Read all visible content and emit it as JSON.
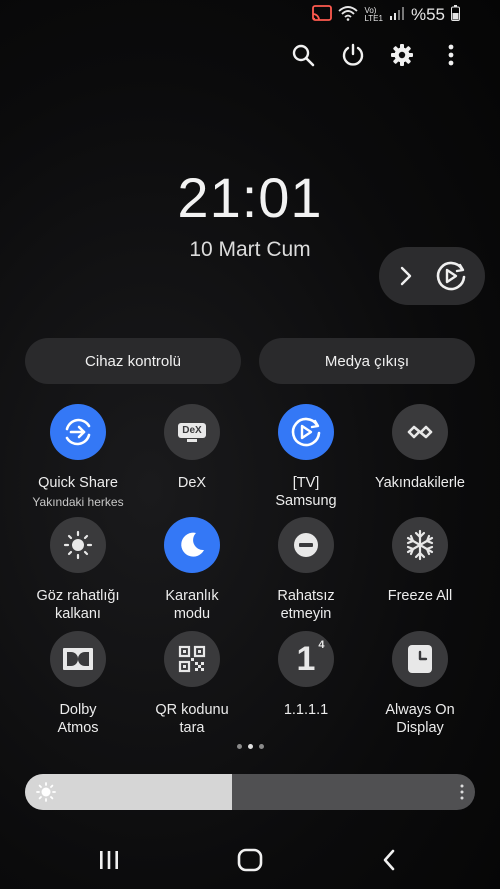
{
  "status_bar": {
    "volte": "Vo)",
    "lte": "LTE1",
    "battery_percent": "%55"
  },
  "clock": {
    "time": "21:01",
    "date": "10 Mart Cum"
  },
  "buttons": {
    "device_control": "Cihaz kontrolü",
    "media_output": "Medya çıkışı"
  },
  "tiles": [
    {
      "label": "Quick Share",
      "sub": "Yakındaki herkes",
      "icon": "quick-share-icon",
      "active": true
    },
    {
      "label": "DeX",
      "sub": "",
      "icon": "dex-icon",
      "active": false
    },
    {
      "label": "[TV]\nSamsung",
      "sub": "",
      "icon": "smart-view-icon",
      "active": true
    },
    {
      "label": "Yakındakilerle",
      "sub": "",
      "icon": "nearby-share-icon",
      "active": false
    },
    {
      "label": "Göz rahatlığı\nkalkanı",
      "sub": "",
      "icon": "eye-comfort-icon",
      "active": false
    },
    {
      "label": "Karanlık\nmodu",
      "sub": "",
      "icon": "moon-icon",
      "active": true
    },
    {
      "label": "Rahatsız\netmeyin",
      "sub": "",
      "icon": "do-not-disturb-icon",
      "active": false
    },
    {
      "label": "Freeze All",
      "sub": "",
      "icon": "snowflake-icon",
      "active": false
    },
    {
      "label": "Dolby\nAtmos",
      "sub": "",
      "icon": "dolby-icon",
      "active": false
    },
    {
      "label": "QR kodunu\ntara",
      "sub": "",
      "icon": "qr-code-icon",
      "active": false
    },
    {
      "label": "1.1.1.1",
      "sub": "",
      "icon": "one-one-one-icon",
      "active": false
    },
    {
      "label": "Always On\nDisplay",
      "sub": "",
      "icon": "always-on-display-icon",
      "active": false
    }
  ],
  "dex_icon_text": "DeX",
  "one_icon_text": "1",
  "one_icon_sup": "4",
  "page_indicator": {
    "total": 3,
    "active_index": 1
  },
  "brightness": {
    "level": 0.46
  },
  "colors": {
    "accent": "#3478f6",
    "tile_off": "#3a3a3c",
    "background": "#0b0b0c"
  }
}
